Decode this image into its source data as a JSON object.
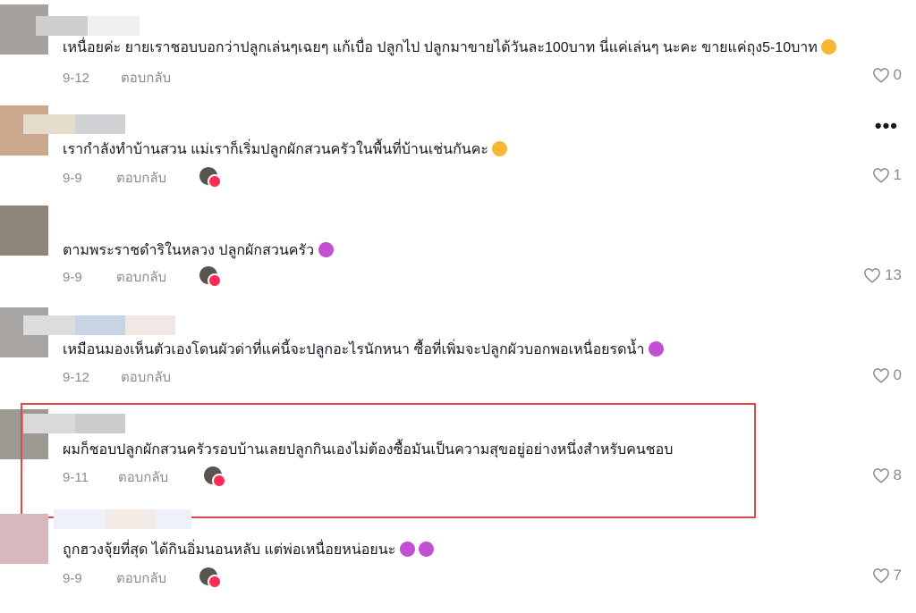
{
  "comments": [
    {
      "text": "เหนื่อยค่ะ ยายเราชอบบอกว่าปลูกเล่นๆเฉยๆ แก้เบื่อ ปลูกไป ปลูกมาขายได้วันละ100บาท นี่แค่เล่นๆ นะคะ ขายแค่ถุง5-10บาท",
      "emoji": "crying-face",
      "date": "9-12",
      "reply": "ตอบกลับ",
      "likes": "0",
      "creator_liked": false,
      "avatar_color": "#a6a19c",
      "name_colors": [
        "#cfcfcf",
        "#e9e9e9"
      ]
    },
    {
      "text": "เรากำลังทำบ้านสวน แม่เราก็เริ่มปลูกผักสวนครัวในพื้นที่บ้านเช่นกันคะ",
      "emoji": "grinning-face",
      "date": "9-9",
      "reply": "ตอบกลับ",
      "likes": "1",
      "creator_liked": true,
      "avatar_color": "#c9a88d",
      "name_colors": [
        "#e6dccb",
        "#cfd1d4"
      ]
    },
    {
      "text": "ตามพระราชดำริในหลวง ปลูกผักสวนครัว",
      "emoji": "rolling-laughing-face",
      "date": "9-9",
      "reply": "ตอบกลับ",
      "likes": "13",
      "creator_liked": true,
      "avatar_color": "#8f8578",
      "name_colors": []
    },
    {
      "text": "เหมือนมองเห็นตัวเองโดนผัวด่าที่แค่นี้จะปลูกอะไรนักหนา ซื้อที่เพิ่มจะปลูกผัวบอกพอเหนื่อยรดน้ำ",
      "emoji": "rolling-laughing-face",
      "date": "9-12",
      "reply": "ตอบกลับ",
      "likes": "0",
      "creator_liked": false,
      "avatar_color": "#a8a4a2",
      "name_colors": [
        "#dcdcdc",
        "#c8d4e6",
        "#efe8e4"
      ]
    },
    {
      "text": "ผมก็ชอบปลูกผักสวนครัวรอบบ้านเลยปลูกกินเองไม่ต้องซื้อมันเป็นความสุขอยู่อย่างหนึ่งสำหรับคนชอบ",
      "emoji": "",
      "date": "9-11",
      "reply": "ตอบกลับ",
      "likes": "8",
      "creator_liked": true,
      "avatar_color": "#9d9a94",
      "name_colors": [
        "#d9d9d9",
        "#cbcbcb"
      ]
    },
    {
      "text": "ถูกฮวงจุ้ยที่สุด ได้กินอิ่มนอนหลับ แต่พ่อเหนื่อยหน่อยนะ",
      "emoji": "rolling-laughing-face",
      "emoji2": "rolling-laughing-face",
      "date": "9-9",
      "reply": "ตอบกลับ",
      "likes": "7",
      "creator_liked": true,
      "avatar_color": "#d8b8bc",
      "name_colors": [
        "#eef2f8",
        "#f2ebe6",
        "#eef2f8"
      ]
    }
  ],
  "highlight_color": "#e0474c",
  "like_icon": "heart-outline-icon",
  "more_icon": "more-options-icon"
}
